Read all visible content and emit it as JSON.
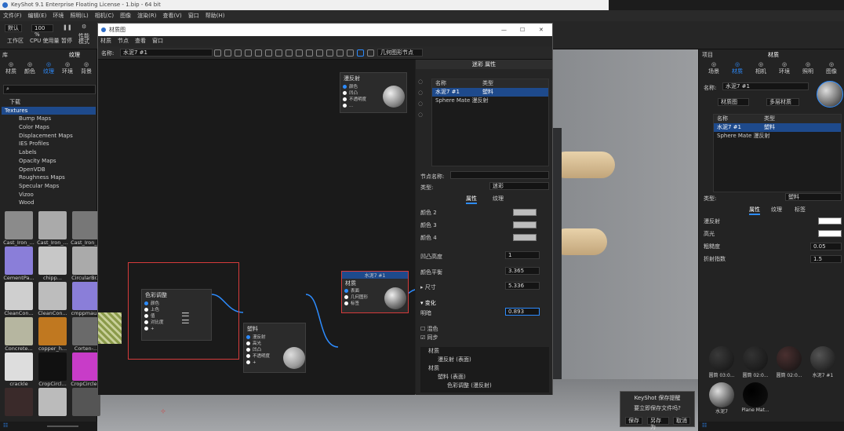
{
  "app": {
    "title": "KeyShot 9.1 Enterprise Floating License - 1.bip - 64 bit",
    "menu": [
      "文件(F)",
      "编辑(E)",
      "环境",
      "照明(L)",
      "相机(C)",
      "图像",
      "渲染(R)",
      "查看(V)",
      "窗口",
      "帮助(H)"
    ]
  },
  "toolbar": {
    "preset": "默认",
    "zoom": "100 %",
    "labels": [
      "工作区",
      "CPU 使用量",
      "暂停",
      "性能\n模式"
    ]
  },
  "library": {
    "title": "库",
    "subtitle": "纹理",
    "tabs": [
      "材质",
      "颜色",
      "纹理",
      "环境",
      "背景"
    ],
    "tree": [
      "下载",
      "Textures",
      "Bump Maps",
      "Color Maps",
      "Displacement Maps",
      "IES Profiles",
      "Labels",
      "Opacity Maps",
      "OpenVDB",
      "Roughness Maps",
      "Specular Maps",
      "Vizoo",
      "Wood"
    ],
    "thumbs": [
      "Cast_Iron_...",
      "Cast_Iron_...",
      "Cast_Iron_...",
      "CementPa...",
      "chipp...",
      "CircularBr...",
      "CleanCon...",
      "CleanCon...",
      "cmppmau...",
      "Concrete...",
      "copper_h...",
      "Corten-...",
      "crackle",
      "CropCircl...",
      "CropCircle...",
      "",
      "",
      ""
    ]
  },
  "graph": {
    "title": "材质图",
    "menu": [
      "材质",
      "节点",
      "查看",
      "窗口"
    ],
    "name_label": "名称:",
    "name_value": "水泥7 #1",
    "geom_btn": "几何图形节点",
    "win": [
      "—",
      "☐",
      "✕"
    ],
    "nodes": {
      "diffuse": {
        "title": "漫反射",
        "ports": [
          "颜色",
          "凹凸",
          "不透明度",
          "..."
        ]
      },
      "color_adjust": {
        "title": "色彩调整",
        "ports": [
          "颜色",
          "上色",
          "值",
          "对比度",
          "+"
        ]
      },
      "plastic": {
        "title": "塑料",
        "ports": [
          "漫反射",
          "高光",
          "凹凸",
          "不透明度",
          "+"
        ]
      },
      "material": {
        "header": "水泥7 #1",
        "title": "材质",
        "ports": [
          "表面",
          "几何图形",
          "标签"
        ]
      }
    }
  },
  "props": {
    "title": "迷彩 属性",
    "cols": [
      "名称",
      "类型"
    ],
    "rows": [
      {
        "name": "水泥7 #1",
        "type": "塑料"
      },
      {
        "name": "Sphere Mate 漫反射",
        "type": ""
      }
    ],
    "node_name_label": "节点名称:",
    "type_label": "类型:",
    "type_value": "迷彩",
    "tabs": [
      "属性",
      "纹理"
    ],
    "colors": [
      "颜色 2",
      "颜色 3",
      "颜色 4"
    ],
    "bump_label": "凹凸高度",
    "bump_val": "1",
    "balance_label": "颜色平衡",
    "balance_val": "3.365",
    "scale_label": "▸ 尺寸",
    "scale_val": "5.336",
    "variation_head": "▾ 变化",
    "bright_label": "明暗",
    "bright_val": "0.893",
    "check1": "混色",
    "check2": "同步",
    "tree": [
      "材质",
      "漫反射 (表面)",
      "材质",
      "塑料 (表面)",
      "色彩调整 (漫反射)"
    ]
  },
  "project": {
    "title": "项目",
    "subtitle": "材质",
    "tabs": [
      "场景",
      "材质",
      "相机",
      "环境",
      "照明",
      "图像"
    ],
    "name_label": "名称:",
    "name_value": "水泥7 #1",
    "btn1": "材质图",
    "btn2": "多层材质",
    "cols": [
      "名称",
      "类型"
    ],
    "rows": [
      {
        "name": "水泥7 #1",
        "type": "塑料"
      },
      {
        "name": "Sphere Mate 漫反射",
        "type": ""
      }
    ],
    "type_label": "类型:",
    "type_value": "塑料",
    "tabs2": [
      "属性",
      "纹理",
      "标签"
    ],
    "props": [
      {
        "label": "漫反射",
        "val": ""
      },
      {
        "label": "高光",
        "val": ""
      },
      {
        "label": "粗糙度",
        "val": "0.05"
      },
      {
        "label": "折射指数",
        "val": "1.5"
      }
    ],
    "thumbs": [
      "圆筒 03:0...",
      "圆筒 02:0...",
      "圆筒 02:0...",
      "水泥7 #1",
      "水泥7",
      "Plane Mat..."
    ]
  },
  "dialog": {
    "title": "KeyShot 保存提醒",
    "msg": "要立即保存文件吗?",
    "buttons": [
      "保存",
      "另存为",
      "取消"
    ]
  },
  "colors": {
    "accent": "#2d8cff",
    "highlight": "#d53b3b"
  }
}
